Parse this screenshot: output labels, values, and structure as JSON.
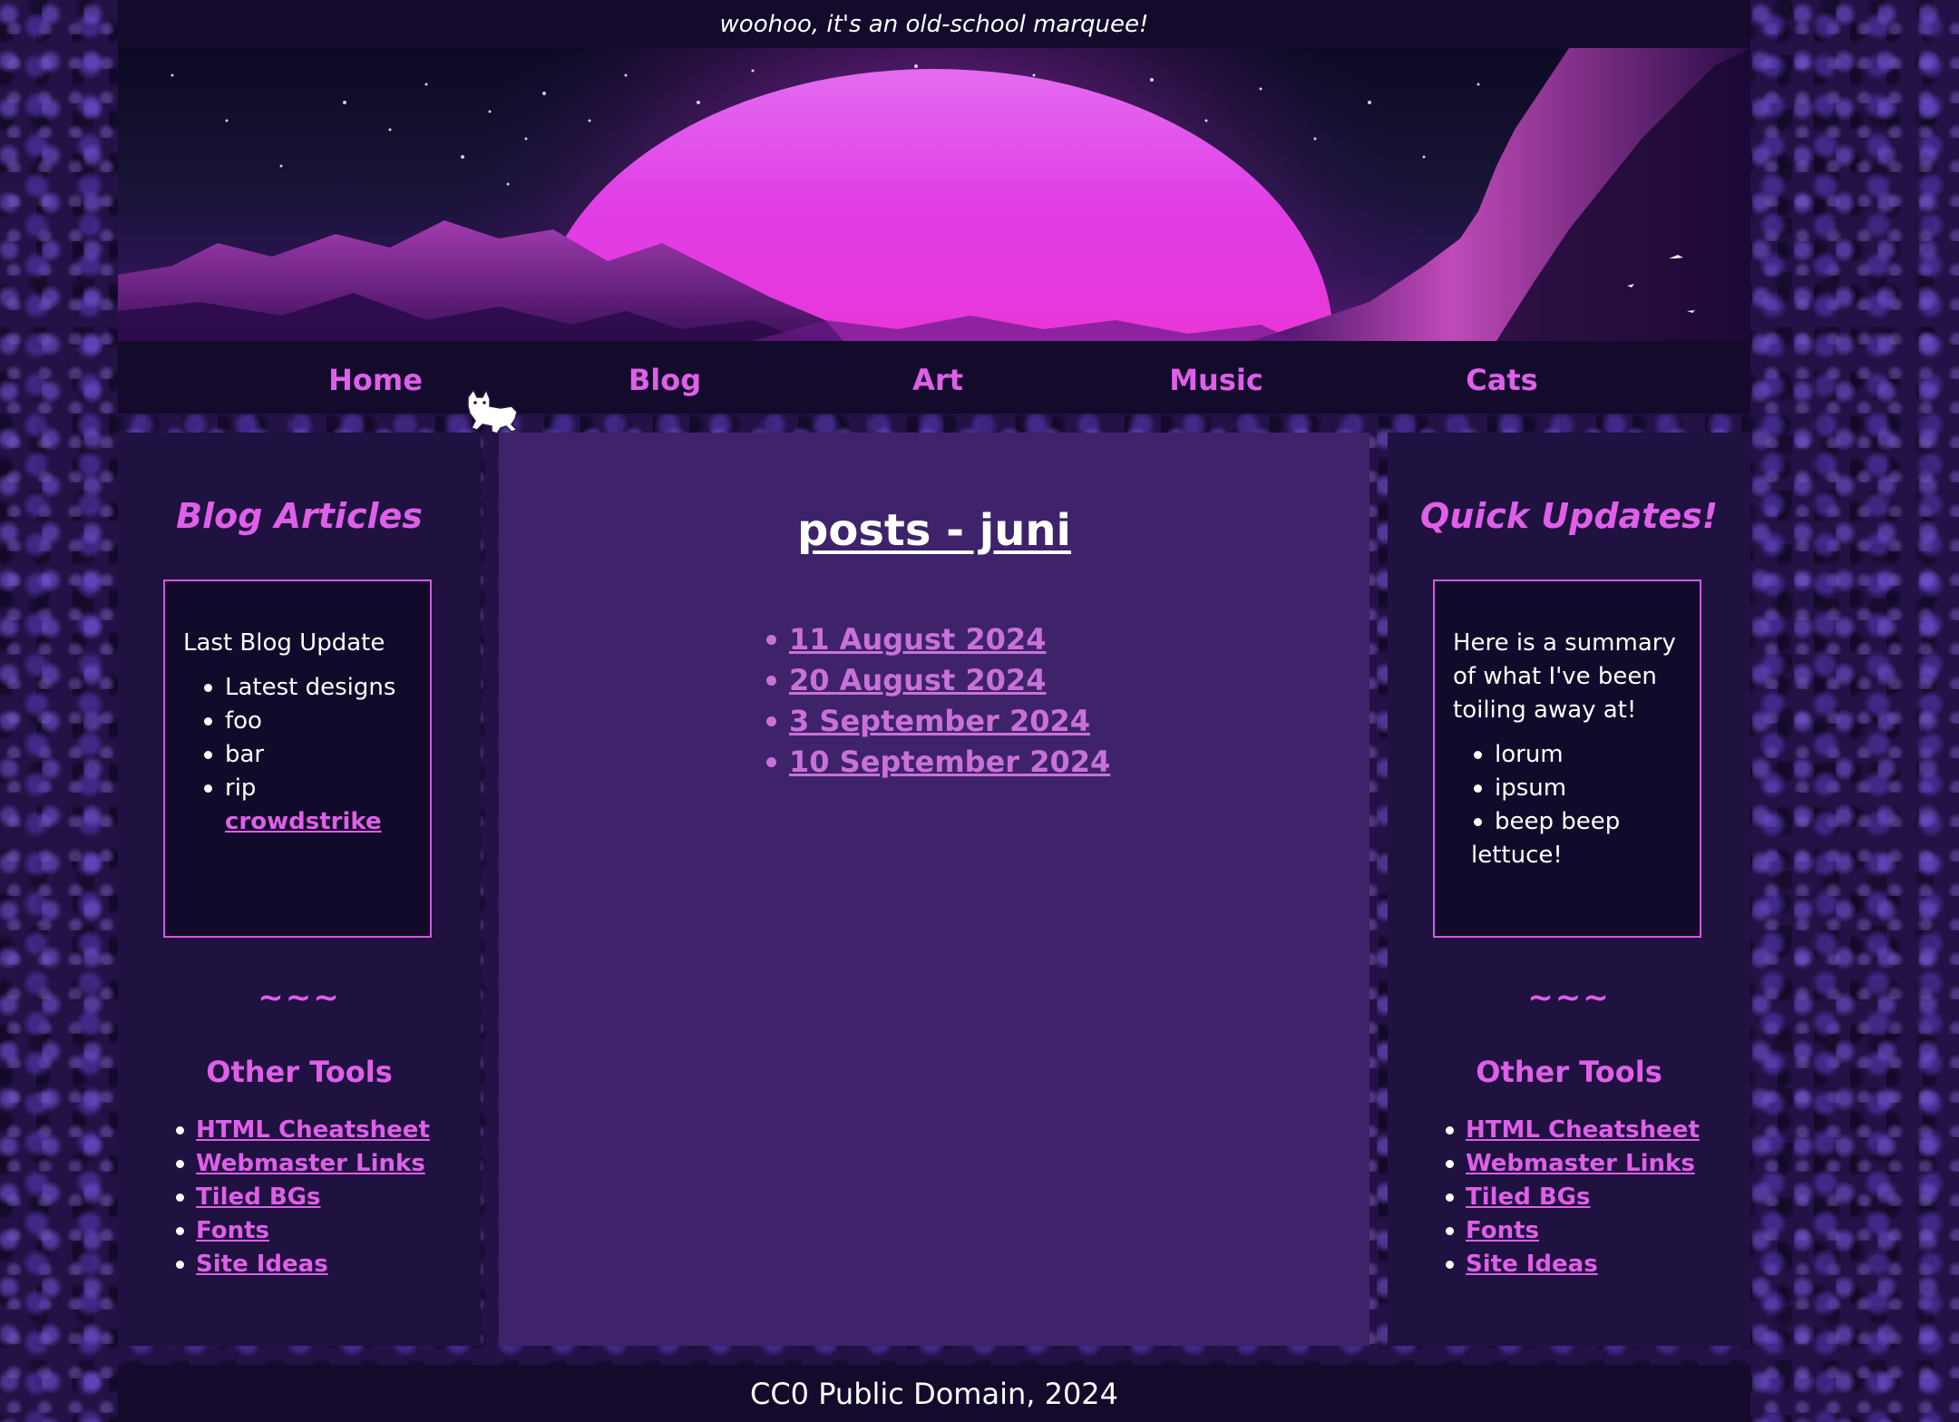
{
  "marquee": {
    "text": "woohoo, it's an old-school marquee!"
  },
  "nav": {
    "items": [
      {
        "label": "Home"
      },
      {
        "label": "Blog"
      },
      {
        "label": "Art"
      },
      {
        "label": "Music"
      },
      {
        "label": "Cats"
      }
    ]
  },
  "left_sidebar": {
    "title": "Blog Articles",
    "box": {
      "heading": "Last Blog Update",
      "items": [
        "Latest designs",
        "foo",
        "bar"
      ],
      "last_item_prefix": "rip ",
      "last_item_link": "crowdstrike"
    },
    "divider": "~~~",
    "tools_title": "Other Tools",
    "tools": [
      "HTML Cheatsheet",
      "Webmaster Links",
      "Tiled BGs",
      "Fonts",
      "Site Ideas"
    ]
  },
  "main": {
    "title": "posts - juni",
    "posts": [
      "11 August 2024",
      "20 August 2024",
      "3 September 2024",
      "10 September 2024"
    ]
  },
  "right_sidebar": {
    "title": "Quick Updates!",
    "box": {
      "paragraph": "Here is a summary of what I've been toiling away at!",
      "items": [
        "lorum",
        "ipsum",
        "beep beep"
      ],
      "trailing": "lettuce!"
    },
    "divider": "~~~",
    "tools_title": "Other Tools",
    "tools": [
      "HTML Cheatsheet",
      "Webmaster Links",
      "Tiled BGs",
      "Fonts",
      "Site Ideas"
    ]
  },
  "footer": {
    "text": "CC0 Public Domain, 2024"
  },
  "colors": {
    "accent": "#df5fe8",
    "panel": "#1f1140",
    "main_panel": "#3e236b",
    "bar": "#130a2c"
  },
  "icons": {
    "cursor": "white-cat-cursor-icon"
  }
}
